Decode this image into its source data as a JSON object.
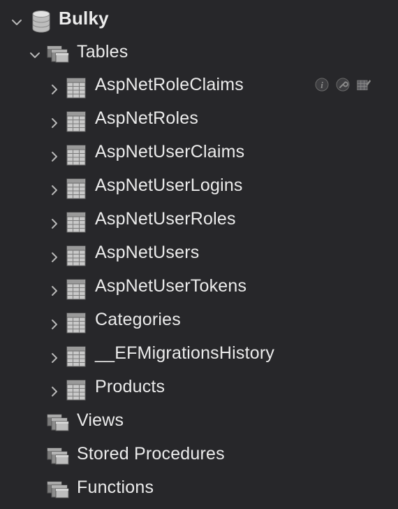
{
  "database": {
    "name": "Bulky",
    "icon": "database-icon"
  },
  "folders": {
    "tables": {
      "label": "Tables",
      "icon": "folder-stack-icon",
      "items": [
        {
          "label": "AspNetRoleClaims"
        },
        {
          "label": "AspNetRoles"
        },
        {
          "label": "AspNetUserClaims"
        },
        {
          "label": "AspNetUserLogins"
        },
        {
          "label": "AspNetUserRoles"
        },
        {
          "label": "AspNetUsers"
        },
        {
          "label": "AspNetUserTokens"
        },
        {
          "label": "Categories"
        },
        {
          "label": "__EFMigrationsHistory"
        },
        {
          "label": "Products"
        }
      ]
    },
    "views": {
      "label": "Views",
      "icon": "folder-stack-icon"
    },
    "stored_procedures": {
      "label": "Stored Procedures",
      "icon": "folder-stack-icon"
    },
    "functions": {
      "label": "Functions",
      "icon": "folder-stack-icon"
    }
  },
  "row_actions": [
    {
      "name": "info-icon"
    },
    {
      "name": "wrench-icon"
    },
    {
      "name": "table-edit-icon"
    }
  ],
  "colors": {
    "background": "#27272a",
    "text": "#ececec",
    "chevron": "#b8b8b8",
    "icon_fill": "#9a9a9a"
  }
}
